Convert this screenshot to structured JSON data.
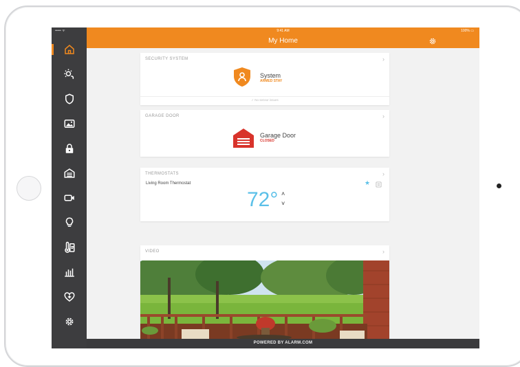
{
  "status_bar": {
    "carrier": "••••• ᯤ",
    "time": "9:41 AM",
    "battery": "100% ▭"
  },
  "header": {
    "title": "My Home"
  },
  "sidebar": {
    "items": [
      {
        "icon": "home-icon",
        "active": true
      },
      {
        "icon": "brightness-icon"
      },
      {
        "icon": "shield-icon"
      },
      {
        "icon": "image-icon"
      },
      {
        "icon": "lock-icon"
      },
      {
        "icon": "garage-icon"
      },
      {
        "icon": "video-camera-icon"
      },
      {
        "icon": "lightbulb-icon"
      },
      {
        "icon": "thermometer-icon"
      },
      {
        "icon": "bar-chart-icon"
      },
      {
        "icon": "heart-plus-icon"
      },
      {
        "icon": "gear-icon"
      }
    ]
  },
  "cards": {
    "security": {
      "title": "SECURITY SYSTEM",
      "name": "System",
      "state": "ARMED STAY",
      "footer": "No sensor issues"
    },
    "garage": {
      "title": "GARAGE DOOR",
      "name": "Garage Door",
      "state": "CLOSED"
    },
    "thermostat": {
      "title": "THERMOSTATS",
      "name": "Living Room Thermostat",
      "temp": "72°"
    },
    "video": {
      "title": "VIDEO"
    }
  },
  "footer": {
    "brand": "POWERED BY ALARM.COM"
  },
  "colors": {
    "accent": "#f0891f",
    "garage_red": "#d8332b",
    "temp_blue": "#5bc0e8"
  }
}
